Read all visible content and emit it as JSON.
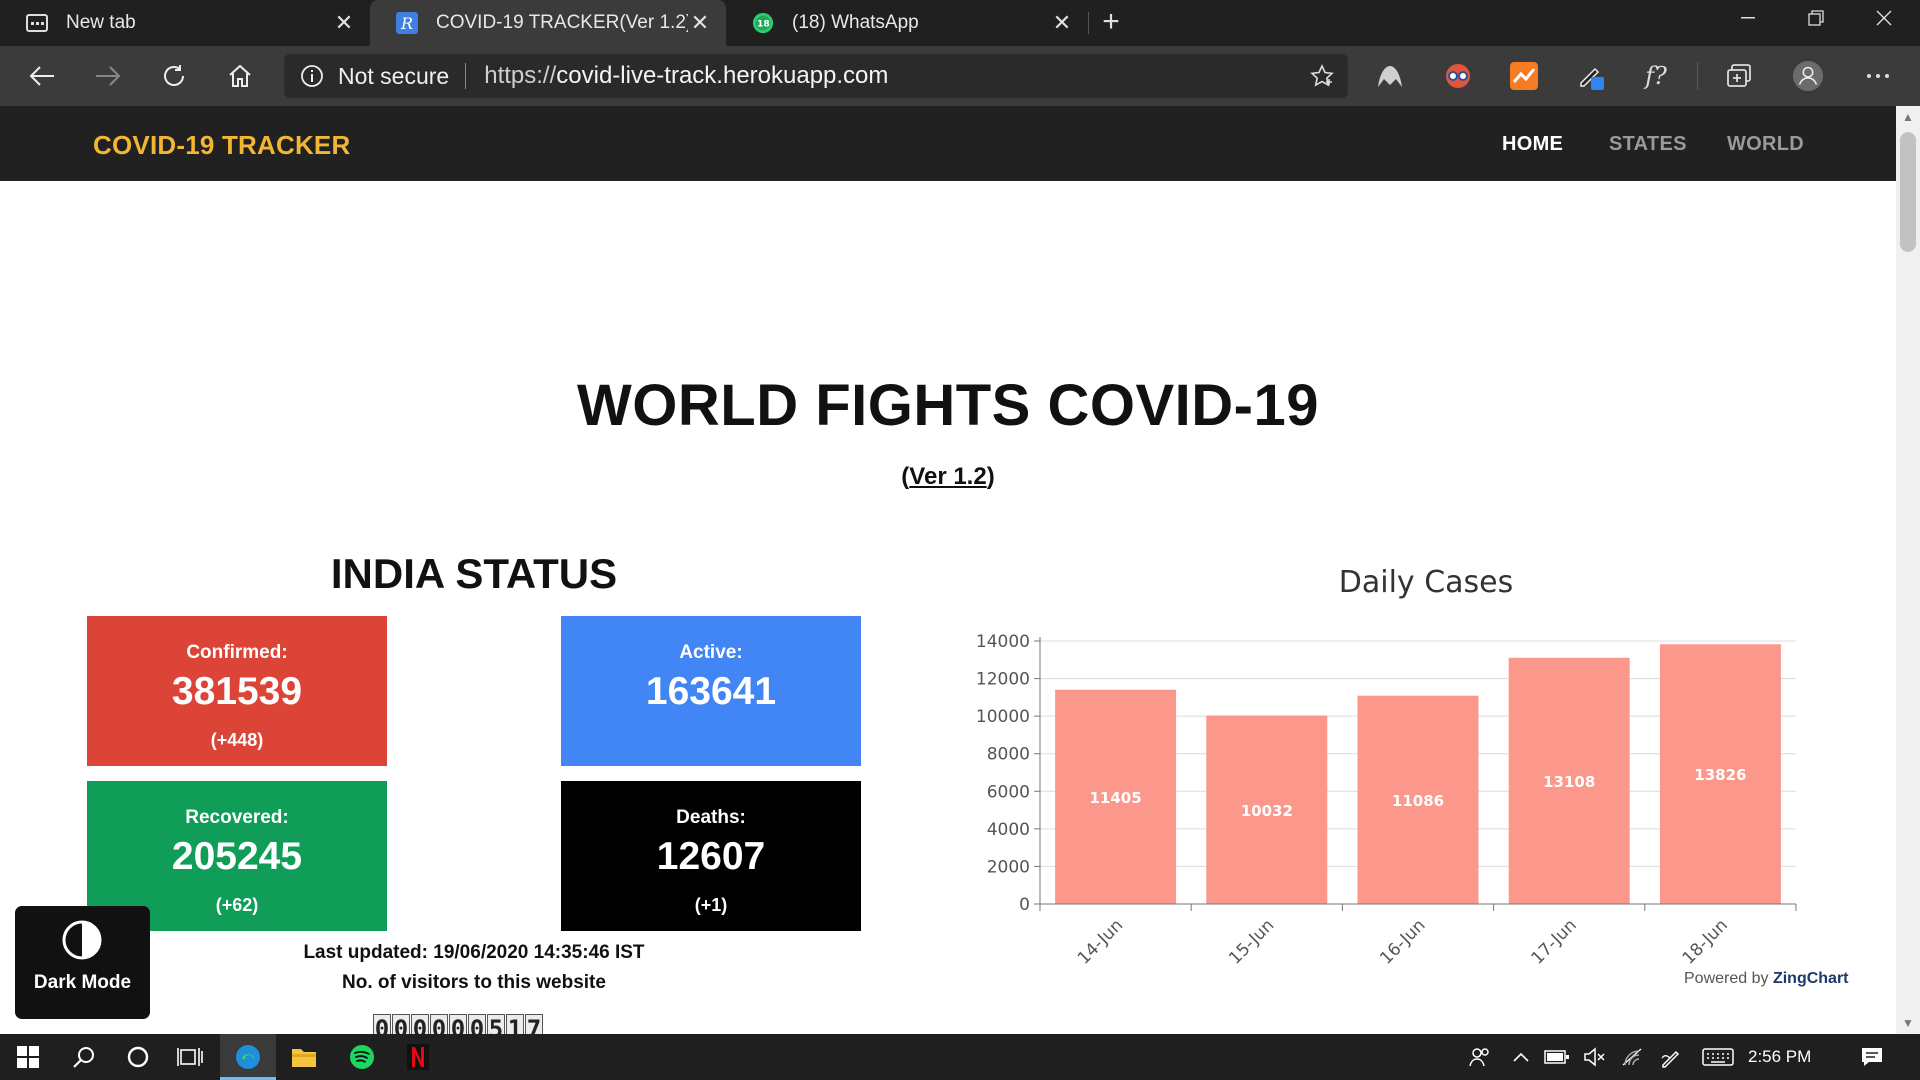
{
  "browser": {
    "tabs": [
      {
        "title": "New tab",
        "icon": "new-tab-page-icon",
        "active": false
      },
      {
        "title": "COVID-19 TRACKER(Ver 1.2)",
        "icon": "site-favicon-icon",
        "active": true
      },
      {
        "title": "(18) WhatsApp",
        "icon": "whatsapp-icon",
        "badge": "18",
        "active": false
      }
    ],
    "security_label": "Not secure",
    "url_scheme": "https://",
    "url_host": "covid-live-track.herokuapp.com"
  },
  "site": {
    "brand": "COVID-19 TRACKER",
    "nav": [
      {
        "label": "HOME",
        "active": true
      },
      {
        "label": "STATES",
        "active": false
      },
      {
        "label": "WORLD",
        "active": false
      }
    ],
    "title": "WORLD FIGHTS COVID-19",
    "version_open": "(",
    "version_text": "Ver 1.2",
    "version_close": ")",
    "india": {
      "title": "INDIA STATUS",
      "confirmed": {
        "label": "Confirmed:",
        "value": "381539",
        "delta": "(+448)",
        "color": "#db4437"
      },
      "active": {
        "label": "Active:",
        "value": "163641",
        "delta": "",
        "color": "#4285f4"
      },
      "recovered": {
        "label": "Recovered:",
        "value": "205245",
        "delta": "(+62)",
        "color": "#0f9d58"
      },
      "deaths": {
        "label": "Deaths:",
        "value": "12607",
        "delta": "(+1)",
        "color": "#000000"
      }
    },
    "last_updated": "Last updated: 19/06/2020 14:35:46 IST",
    "visitors_label": "No. of visitors to this website",
    "visitor_count": [
      "0",
      "0",
      "0",
      "0",
      "0",
      "0",
      "5",
      "1",
      "7"
    ],
    "dark_mode_label": "Dark Mode",
    "powered_by": "Powered by",
    "powered_brand": "ZingChart"
  },
  "chart_data": {
    "type": "bar",
    "title": "Daily Cases",
    "categories": [
      "14-Jun",
      "15-Jun",
      "16-Jun",
      "17-Jun",
      "18-Jun"
    ],
    "values": [
      11405,
      10032,
      11086,
      13108,
      13826
    ],
    "ylim": [
      0,
      14000
    ],
    "yticks": [
      0,
      2000,
      4000,
      6000,
      8000,
      10000,
      12000,
      14000
    ],
    "bar_color": "#fb978b",
    "grid": true,
    "legend": "none"
  },
  "taskbar": {
    "clock": "2:56 PM"
  }
}
